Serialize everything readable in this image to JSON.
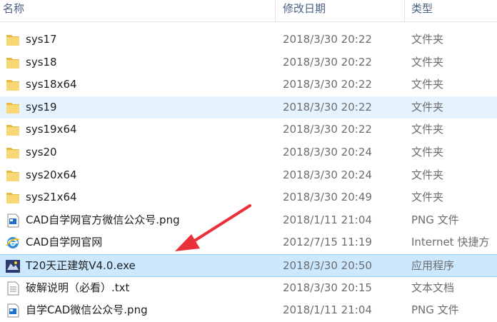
{
  "header": {
    "name_label": "名称",
    "date_label": "修改日期",
    "type_label": "类型"
  },
  "files": [
    {
      "name": "sys17",
      "date": "2018/3/30 20:22",
      "type": "文件夹",
      "icon": "folder-icon"
    },
    {
      "name": "sys18",
      "date": "2018/3/30 20:22",
      "type": "文件夹",
      "icon": "folder-icon"
    },
    {
      "name": "sys18x64",
      "date": "2018/3/30 20:22",
      "type": "文件夹",
      "icon": "folder-icon"
    },
    {
      "name": "sys19",
      "date": "2018/3/30 20:22",
      "type": "文件夹",
      "icon": "folder-icon",
      "state": "hover"
    },
    {
      "name": "sys19x64",
      "date": "2018/3/30 20:22",
      "type": "文件夹",
      "icon": "folder-icon"
    },
    {
      "name": "sys20",
      "date": "2018/3/30 20:24",
      "type": "文件夹",
      "icon": "folder-icon"
    },
    {
      "name": "sys20x64",
      "date": "2018/3/30 20:24",
      "type": "文件夹",
      "icon": "folder-icon"
    },
    {
      "name": "sys21x64",
      "date": "2018/3/30 20:49",
      "type": "文件夹",
      "icon": "folder-icon"
    },
    {
      "name": "CAD自学网官方微信公众号.png",
      "date": "2018/1/11 21:04",
      "type": "PNG 文件",
      "icon": "image-file-icon"
    },
    {
      "name": "CAD自学网官网",
      "date": "2012/7/15 11:19",
      "type": "Internet 快捷方",
      "icon": "internet-shortcut-icon"
    },
    {
      "name": "T20天正建筑V4.0.exe",
      "date": "2018/3/30 20:50",
      "type": "应用程序",
      "icon": "application-icon",
      "state": "selected"
    },
    {
      "name": "破解说明（必看）.txt",
      "date": "2018/3/30 20:15",
      "type": "文本文档",
      "icon": "text-file-icon"
    },
    {
      "name": "自学CAD微信公众号.png",
      "date": "2018/1/11 21:04",
      "type": "PNG 文件",
      "icon": "image-file-icon"
    }
  ],
  "colors": {
    "folder": "#f8d775",
    "header_text": "#4d6082",
    "selected_bg": "#cce8ff",
    "hover_bg": "#e5f3ff",
    "arrow": "#e8313b"
  }
}
